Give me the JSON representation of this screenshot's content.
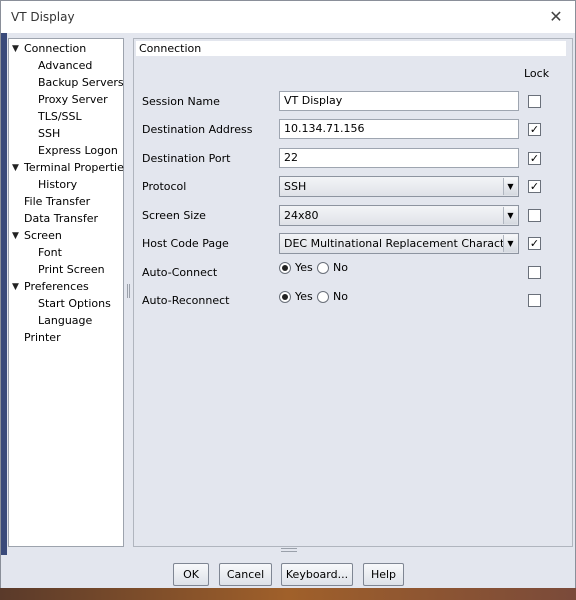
{
  "window": {
    "title": "VT Display",
    "close_icon": "close-icon"
  },
  "tree": [
    {
      "label": "Connection",
      "expanded": true,
      "level": 0
    },
    {
      "label": "Advanced",
      "level": 1
    },
    {
      "label": "Backup Servers",
      "level": 1
    },
    {
      "label": "Proxy Server",
      "level": 1
    },
    {
      "label": "TLS/SSL",
      "level": 1
    },
    {
      "label": "SSH",
      "level": 1
    },
    {
      "label": "Express Logon",
      "level": 1
    },
    {
      "label": "Terminal Properties",
      "expanded": true,
      "level": 0
    },
    {
      "label": "History",
      "level": 1
    },
    {
      "label": "File Transfer",
      "level": 0
    },
    {
      "label": "Data Transfer",
      "level": 0
    },
    {
      "label": "Screen",
      "expanded": true,
      "level": 0
    },
    {
      "label": "Font",
      "level": 1
    },
    {
      "label": "Print Screen",
      "level": 1
    },
    {
      "label": "Preferences",
      "expanded": true,
      "level": 0
    },
    {
      "label": "Start Options",
      "level": 1
    },
    {
      "label": "Language",
      "level": 1
    },
    {
      "label": "Printer",
      "level": 0
    }
  ],
  "panel": {
    "title": "Connection",
    "lock_header": "Lock",
    "rows": [
      {
        "label": "Session Name",
        "value": "VT Display",
        "locked": false
      },
      {
        "label": "Destination Address",
        "value": "10.134.71.156",
        "locked": true
      },
      {
        "label": "Destination Port",
        "value": "22",
        "locked": true
      },
      {
        "label": "Protocol",
        "value": "SSH",
        "locked": true
      },
      {
        "label": "Screen Size",
        "value": "24x80",
        "locked": false
      },
      {
        "label": "Host Code Page",
        "value": "DEC Multinational Replacement Character Set",
        "locked": true
      },
      {
        "label": "Auto-Connect",
        "yes": "Yes",
        "no": "No",
        "selected": "Yes",
        "locked": false
      },
      {
        "label": "Auto-Reconnect",
        "yes": "Yes",
        "no": "No",
        "selected": "Yes",
        "locked": false
      }
    ]
  },
  "buttons": {
    "ok": "OK",
    "cancel": "Cancel",
    "keyboard": "Keyboard...",
    "help": "Help"
  }
}
